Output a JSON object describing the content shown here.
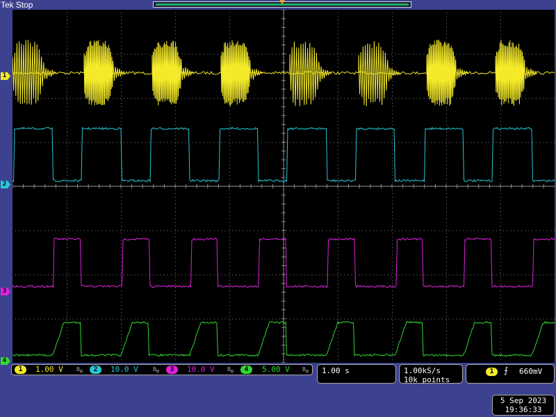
{
  "header": {
    "brand": "Tek",
    "acq_state": "Stop"
  },
  "colors": {
    "ch1": "#f4ea2a",
    "ch2": "#27c8d8",
    "ch3": "#e020e0",
    "ch4": "#30d830",
    "background": "#3c4290",
    "grid": "#8a8a8a"
  },
  "channels": [
    {
      "num": "1",
      "scale": "1.00 V"
    },
    {
      "num": "2",
      "scale": "10.0 V"
    },
    {
      "num": "3",
      "scale": "10.0 V"
    },
    {
      "num": "4",
      "scale": "5.00 V"
    }
  ],
  "timebase": {
    "scale": "1.00 s"
  },
  "acquisition": {
    "rate": "1.00kS/s",
    "record": "10k points"
  },
  "trigger": {
    "source": "1",
    "slope_icon": "rising-edge-icon",
    "level": "660mV"
  },
  "datetime": {
    "date": "5 Sep  2023",
    "time": "19:36:33"
  }
}
